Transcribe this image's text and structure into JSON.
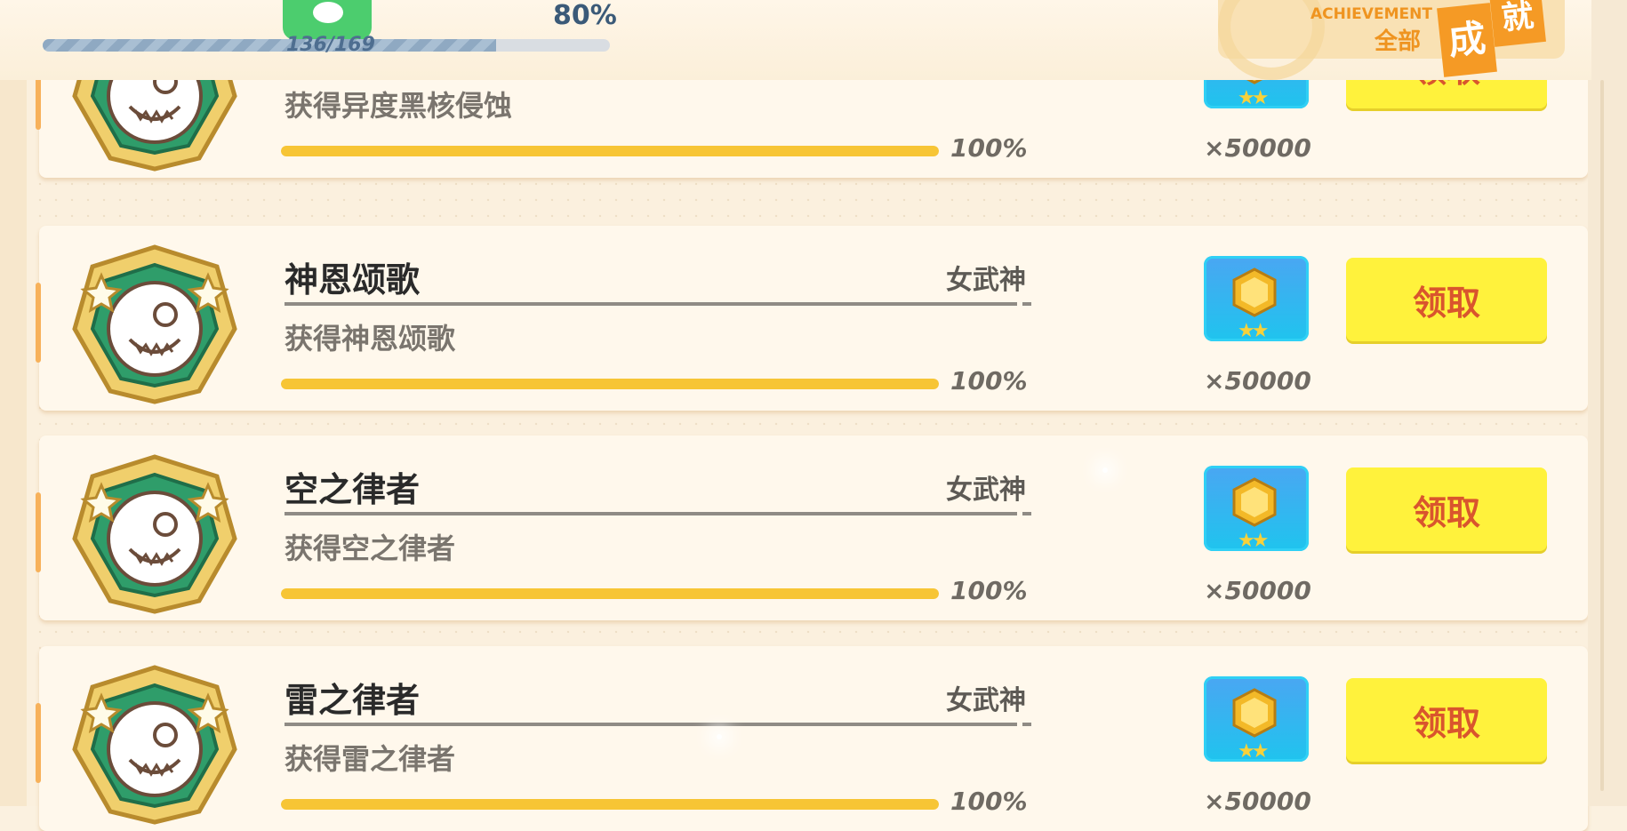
{
  "header": {
    "progress_percent_label": "80%",
    "progress_fraction": 0.8,
    "progress_count": "136/169",
    "achievement_en": "ACHIEVEMENT",
    "filter_label": "全部",
    "title_char_1": "成",
    "title_char_2": "就"
  },
  "colors": {
    "accent_orange": "#f59a25",
    "claim_button": "#fff23c",
    "claim_text": "#d9552d",
    "progress_fill": "#f7c535",
    "reward_tile": "#1fc4ee"
  },
  "achievements": [
    {
      "title": "",
      "category": "",
      "description": "获得异度黑核侵蚀",
      "progress": 1.0,
      "progress_label": "100%",
      "reward_icon": "gold-crystal-icon",
      "reward_qty": "×50000",
      "claim_label": "领取"
    },
    {
      "title": "神恩颂歌",
      "category": "女武神",
      "description": "获得神恩颂歌",
      "progress": 1.0,
      "progress_label": "100%",
      "reward_icon": "gold-crystal-icon",
      "reward_qty": "×50000",
      "claim_label": "领取"
    },
    {
      "title": "空之律者",
      "category": "女武神",
      "description": "获得空之律者",
      "progress": 1.0,
      "progress_label": "100%",
      "reward_icon": "gold-crystal-icon",
      "reward_qty": "×50000",
      "claim_label": "领取"
    },
    {
      "title": "雷之律者",
      "category": "女武神",
      "description": "获得雷之律者",
      "progress": 1.0,
      "progress_label": "100%",
      "reward_icon": "gold-crystal-icon",
      "reward_qty": "×50000",
      "claim_label": "领取"
    }
  ]
}
